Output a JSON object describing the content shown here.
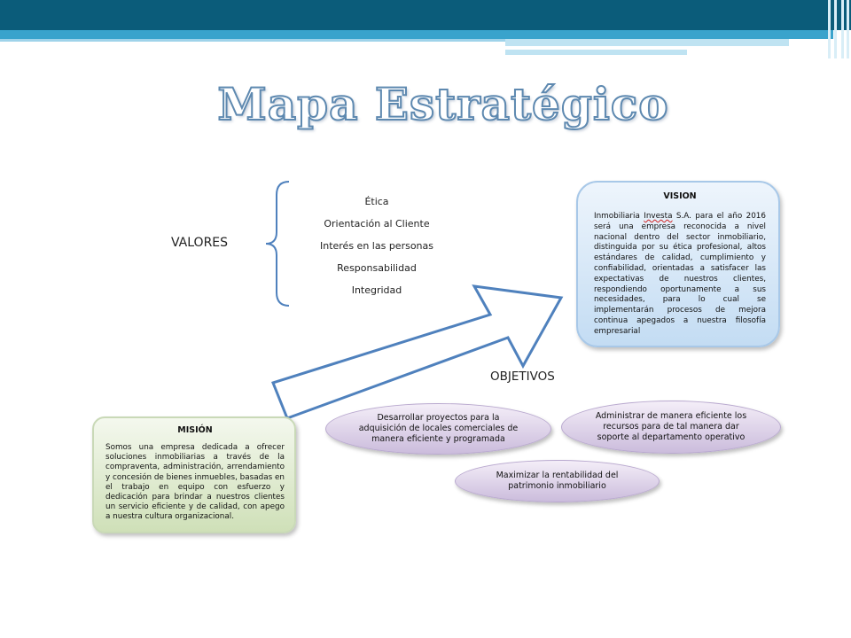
{
  "title": "Mapa Estratégico",
  "valores": {
    "label": "VALORES",
    "items": [
      "Ética",
      "Orientación al Cliente",
      "Interés en las personas",
      "Responsabilidad",
      "Integridad"
    ]
  },
  "vision": {
    "heading": "VISION",
    "text_before": "Inmobiliaria ",
    "text_flagged": "Investa",
    "text_after": " S.A. para el año 2016 será una empresa reconocida a nivel nacional dentro del sector inmobiliario, distinguida por su ética profesional, altos estándares de calidad, cumplimiento y confiabilidad, orientadas a satisfacer las expectativas de nuestros clientes, respondiendo oportunamente a sus necesidades, para lo cual se implementarán procesos de mejora continua apegados a nuestra filosofía empresarial"
  },
  "objetivos": {
    "label": "OBJETIVOS",
    "items": [
      "Desarrollar proyectos para la adquisición de locales comerciales de manera eficiente y programada",
      "Administrar de manera eficiente los recursos para de tal manera dar soporte al departamento operativo",
      "Maximizar la rentabilidad del patrimonio inmobiliario"
    ]
  },
  "mision": {
    "heading": "MISIÓN",
    "text": "Somos una empresa dedicada a ofrecer soluciones inmobiliarias a través de la compraventa, administración, arrendamiento y concesión de bienes inmuebles, basadas en el trabajo en equipo con esfuerzo y dedicación para brindar a nuestros clientes un servicio eficiente y de calidad, con apego a nuestra cultura organizacional."
  },
  "colors": {
    "header_dark": "#0b5c7a",
    "header_light": "#39a3cc",
    "title_outline": "#5e89b0",
    "brace_arrow": "#4f81bd",
    "vision_fill": "#c3dcf3",
    "mision_fill": "#cfe0b8",
    "objetivo_fill": "#cbbcdc"
  }
}
